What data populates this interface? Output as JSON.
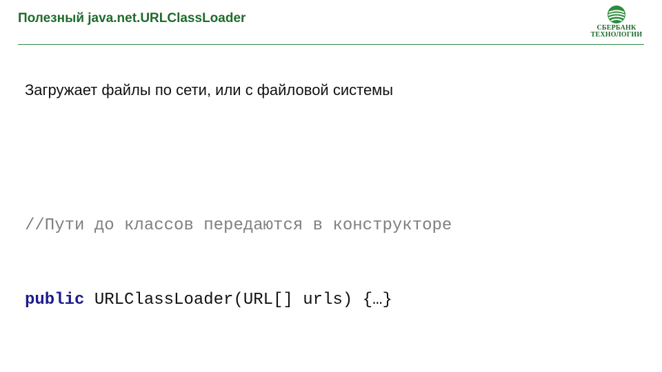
{
  "slide": {
    "title": "Полезный java.net.URLClassLoader",
    "body_text": "Загружает файлы по сети, или с файловой системы"
  },
  "logo": {
    "icon": "sberbank-leaf-icon",
    "line1": "СБЕРБАНК",
    "line2": "ТЕХНОЛОГИИ",
    "color": "#1f6b2c"
  },
  "code": {
    "comment": "//Пути до классов передаются в конструкторе",
    "keyword": "public",
    "signature": " URLClassLoader(URL[] urls) {…}"
  },
  "colors": {
    "title": "#1f6b2c",
    "rule": "#2e8b3d",
    "keyword": "#1c1c8c",
    "comment": "#7f7f7f"
  }
}
